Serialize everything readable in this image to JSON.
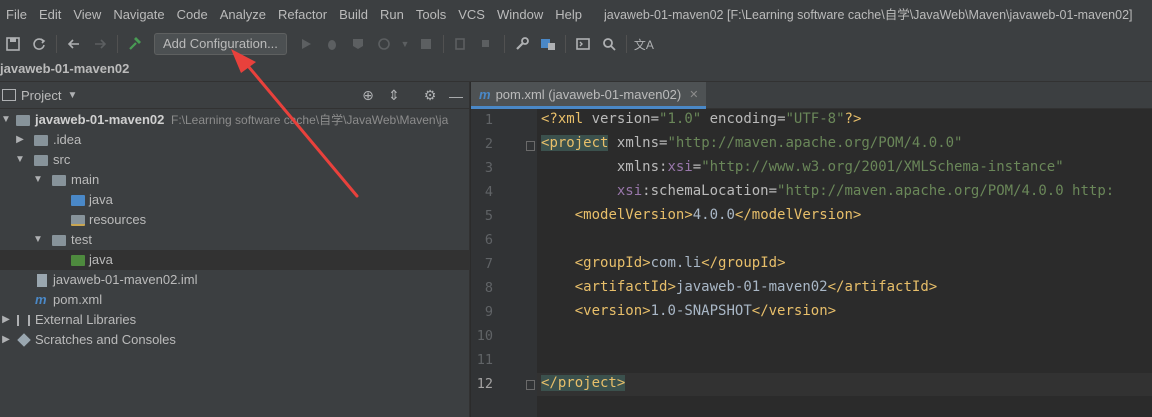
{
  "menu": [
    "File",
    "Edit",
    "View",
    "Navigate",
    "Code",
    "Analyze",
    "Refactor",
    "Build",
    "Run",
    "Tools",
    "VCS",
    "Window",
    "Help"
  ],
  "window_title": "javaweb-01-maven02 [F:\\Learning software cache\\自学\\JavaWeb\\Maven\\javaweb-01-maven02]",
  "toolbar": {
    "add_configuration_label": "Add Configuration..."
  },
  "navbar": {
    "project_name": "javaweb-01-maven02"
  },
  "project_panel": {
    "title": "Project",
    "tree": {
      "root_label": "javaweb-01-maven02",
      "root_path": "F:\\Learning software cache\\自学\\JavaWeb\\Maven\\ja",
      "idea": ".idea",
      "src": "src",
      "main": "main",
      "main_java": "java",
      "resources": "resources",
      "test": "test",
      "test_java": "java",
      "iml": "javaweb-01-maven02.iml",
      "pom": "pom.xml",
      "external_libraries": "External Libraries",
      "scratches": "Scratches and Consoles"
    }
  },
  "editor": {
    "tab_label": "pom.xml (javaweb-01-maven02)",
    "tab_icon": "m",
    "line_numbers": [
      "1",
      "2",
      "3",
      "4",
      "5",
      "6",
      "7",
      "8",
      "9",
      "10",
      "11",
      "12"
    ],
    "current_line": "12",
    "code": {
      "l1_pi": "<?xml ",
      "l1_a1": "version",
      "l1_v1": "\"1.0\"",
      "l1_a2": "encoding",
      "l1_v2": "\"UTF-8\"",
      "l1_end": "?>",
      "l2_tag": "project",
      "l2_attr": "xmlns",
      "l2_val": "\"http://maven.apache.org/POM/4.0.0\"",
      "l3_ns": "xmlns",
      "l3_attr": "xsi",
      "l3_val": "\"http://www.w3.org/2001/XMLSchema-instance\"",
      "l4_ns": "xsi",
      "l4_attr": "schemaLocation",
      "l4_val": "\"http://maven.apache.org/POM/4.0.0 http:",
      "l5_tag": "modelVersion",
      "l5_text": "4.0.0",
      "l7_tag": "groupId",
      "l7_text": "com.li",
      "l8_tag": "artifactId",
      "l8_text": "javaweb-01-maven02",
      "l9_tag": "version",
      "l9_text": "1.0-SNAPSHOT",
      "l12_tag": "project"
    }
  },
  "colors": {
    "annotation_arrow": "#e8413c",
    "accent": "#4a88c7"
  }
}
